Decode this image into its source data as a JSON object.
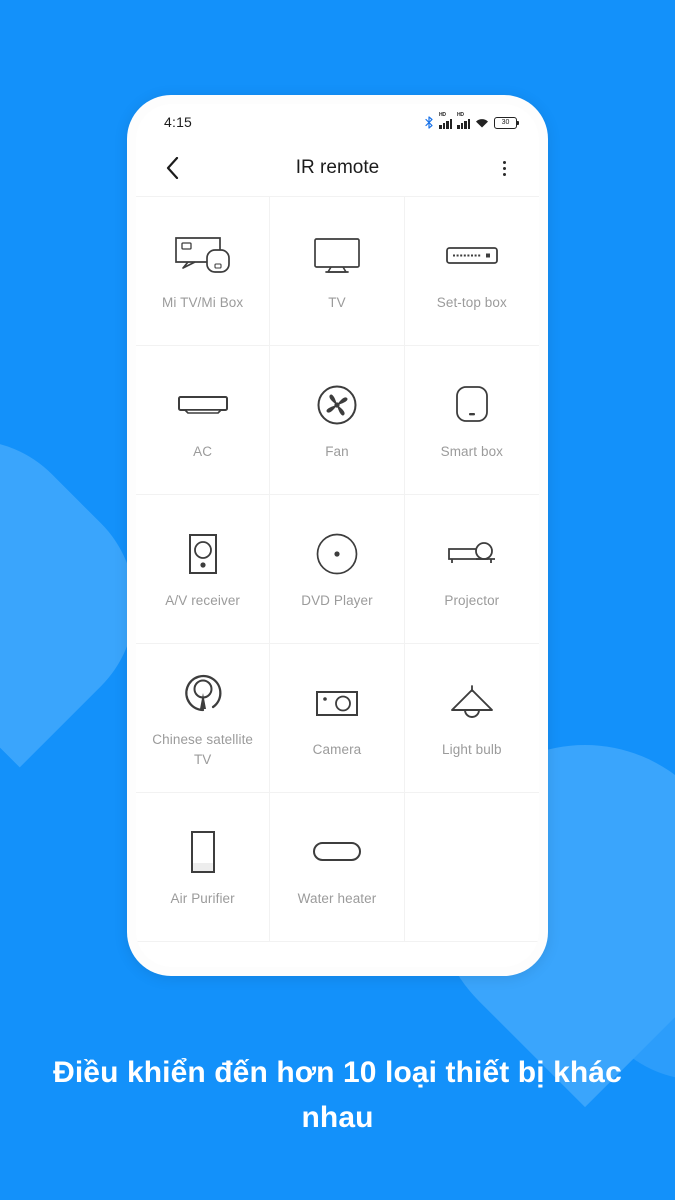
{
  "theme": {
    "background": "#1391FA",
    "blob": "#3AA5FC",
    "phone_body": "#FDFDFD",
    "screen": "#FFFFFF",
    "label_color": "#9b9b9b",
    "icon_stroke": "#3d3d3d",
    "caption_color": "#FFFFFF"
  },
  "statusbar": {
    "time": "4:15",
    "battery_level": "30",
    "icons": [
      "bluetooth-icon",
      "signal-hd-1-icon",
      "signal-hd-2-icon",
      "wifi-icon",
      "battery-icon"
    ]
  },
  "appbar": {
    "back_icon": "chevron-left-icon",
    "title": "IR remote",
    "menu_icon": "overflow-menu-icon"
  },
  "grid": {
    "items": [
      {
        "label": "Mi TV/Mi Box",
        "icon": "mi-tv-box-icon"
      },
      {
        "label": "TV",
        "icon": "tv-icon"
      },
      {
        "label": "Set-top box",
        "icon": "set-top-box-icon"
      },
      {
        "label": "AC",
        "icon": "air-conditioner-icon"
      },
      {
        "label": "Fan",
        "icon": "fan-icon"
      },
      {
        "label": "Smart box",
        "icon": "smart-box-icon"
      },
      {
        "label": "A/V receiver",
        "icon": "av-receiver-icon"
      },
      {
        "label": "DVD Player",
        "icon": "dvd-player-icon"
      },
      {
        "label": "Projector",
        "icon": "projector-icon"
      },
      {
        "label": "Chinese satellite TV",
        "icon": "satellite-dish-icon"
      },
      {
        "label": "Camera",
        "icon": "camera-icon"
      },
      {
        "label": "Light bulb",
        "icon": "light-bulb-icon"
      },
      {
        "label": "Air Purifier",
        "icon": "air-purifier-icon"
      },
      {
        "label": "Water heater",
        "icon": "water-heater-icon"
      },
      {
        "label": "",
        "icon": ""
      }
    ]
  },
  "caption": {
    "text": "Điều khiển đến hơn 10 loại thiết bị khác nhau"
  }
}
